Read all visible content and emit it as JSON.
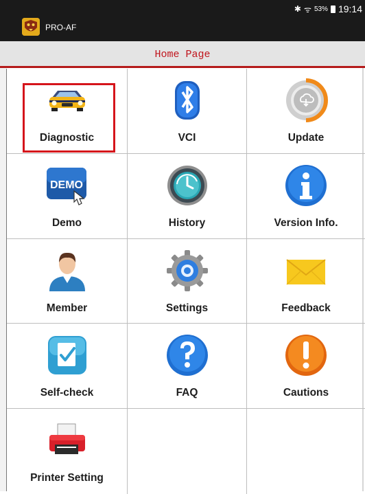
{
  "status_bar": {
    "bluetooth": "✱",
    "wifi": "ᯤ",
    "battery": "53%",
    "time": "19:14"
  },
  "app": {
    "name": "PRO-AF"
  },
  "header": {
    "title": "Home Page"
  },
  "grid": {
    "items": [
      {
        "label": "Diagnostic",
        "icon": "car-icon",
        "selected": true
      },
      {
        "label": "VCI",
        "icon": "bluetooth-icon"
      },
      {
        "label": "Update",
        "icon": "cloud-download-icon"
      },
      {
        "label": "Demo",
        "icon": "demo-icon"
      },
      {
        "label": "History",
        "icon": "history-icon"
      },
      {
        "label": "Version Info.",
        "icon": "info-icon"
      },
      {
        "label": "Member",
        "icon": "member-icon"
      },
      {
        "label": "Settings",
        "icon": "gear-icon"
      },
      {
        "label": "Feedback",
        "icon": "envelope-icon"
      },
      {
        "label": "Self-check",
        "icon": "checklist-icon"
      },
      {
        "label": "FAQ",
        "icon": "question-icon"
      },
      {
        "label": "Cautions",
        "icon": "exclamation-icon"
      },
      {
        "label": "Printer Setting",
        "icon": "printer-icon"
      }
    ],
    "demo_icon_text": "DEMO"
  },
  "colors": {
    "highlight": "#d5141b",
    "title": "#c0141c",
    "title_underline": "#b51b1b"
  }
}
